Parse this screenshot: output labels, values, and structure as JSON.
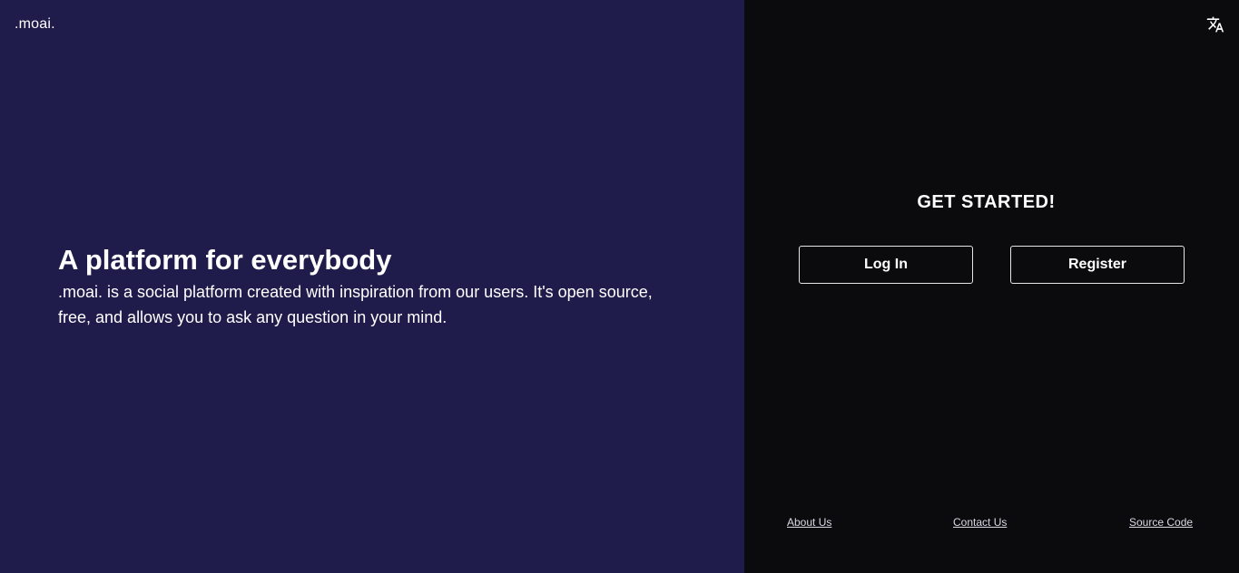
{
  "brand": {
    "logo_text": ".moai."
  },
  "hero": {
    "title": "A platform for everybody",
    "description": ".moai. is a social platform created with inspiration from our users. It's open source, free, and allows you to ask any question in your mind."
  },
  "auth": {
    "heading": "GET STARTED!",
    "login_label": "Log In",
    "register_label": "Register"
  },
  "header": {
    "language_icon": "translate-icon"
  },
  "footer": {
    "links": [
      {
        "label": "About Us"
      },
      {
        "label": "Contact Us"
      },
      {
        "label": "Source Code"
      }
    ]
  },
  "colors": {
    "left_panel_bg": "#1f1b4b",
    "right_panel_bg": "#0b0a0c",
    "text": "#ffffff",
    "button_border": "#e6e6e6"
  }
}
